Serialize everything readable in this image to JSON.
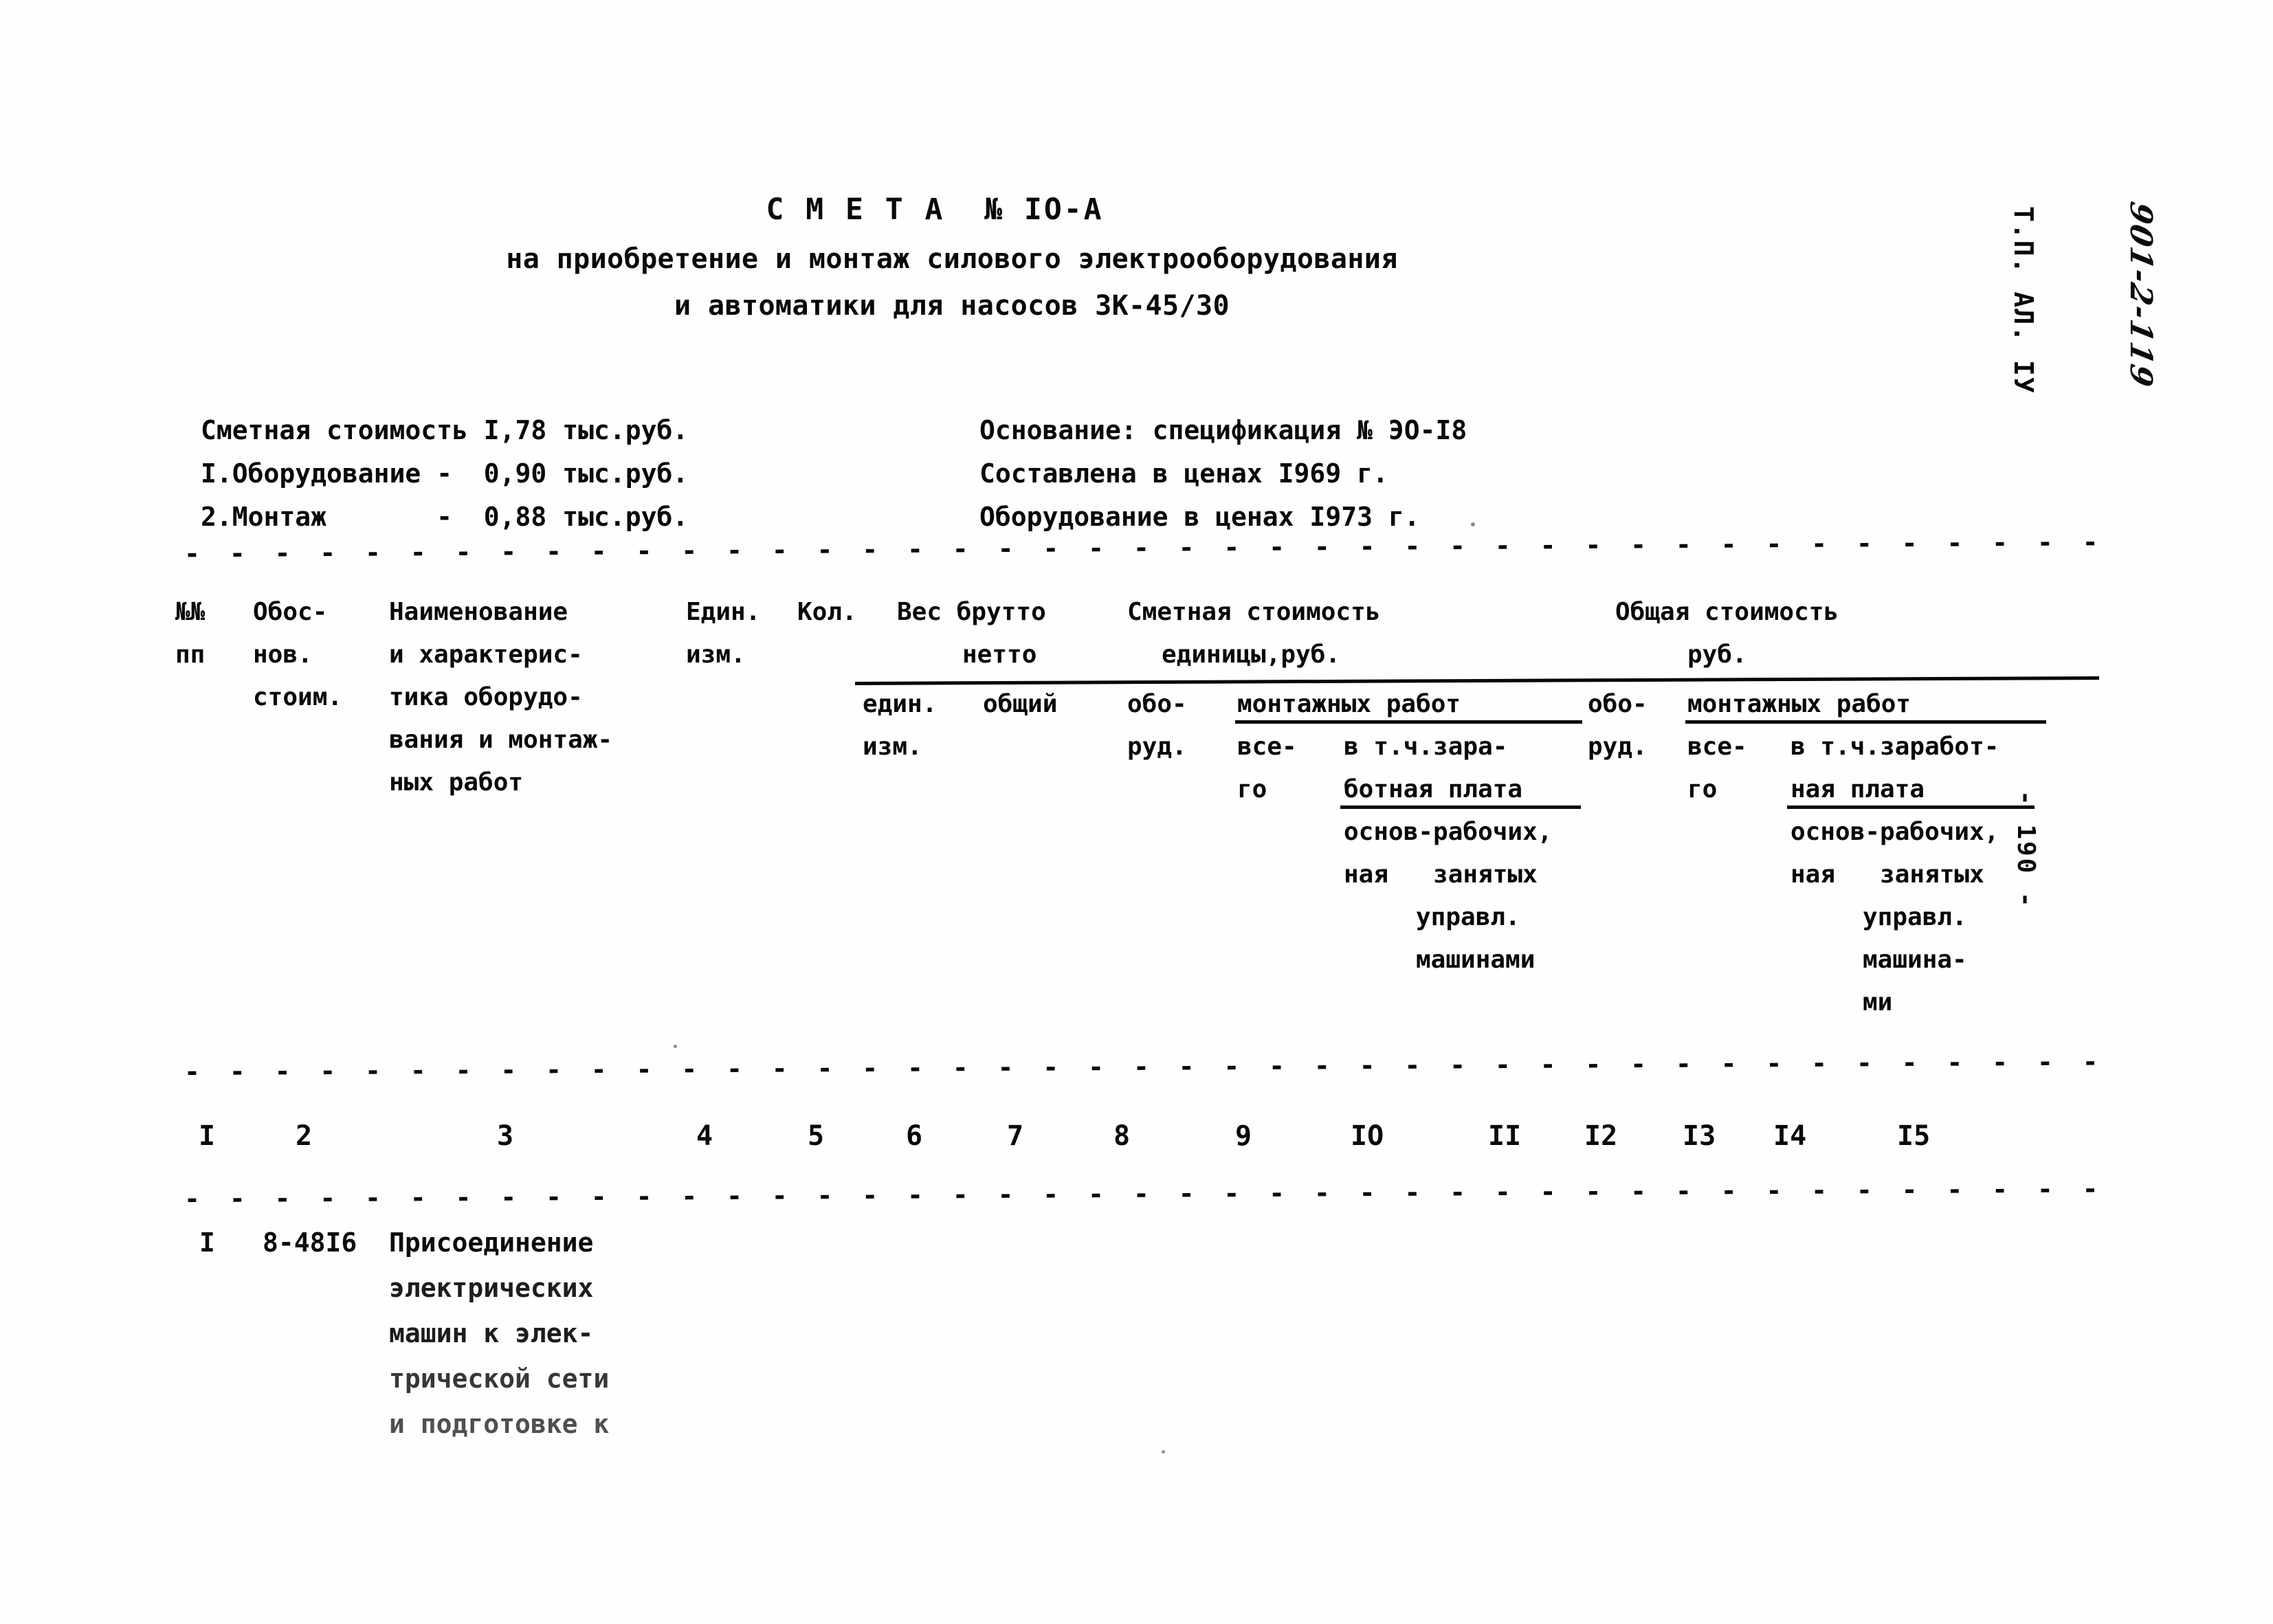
{
  "document": {
    "title": "С М Е Т А  № IО-А",
    "subtitle_line1": "на приобретение и монтаж силового электрооборудования",
    "subtitle_line2": "и автоматики для насосов 3К-45/30",
    "page_number": "- 190 -",
    "margin_stamp_typed": "Т.П. АЛ. IУ",
    "margin_stamp_handwritten": "901-2-119"
  },
  "summary": {
    "left": [
      "Сметная стоимость I,78 тыс.руб.",
      "I.Оборудование -  0,90 тыс.руб.",
      "2.Монтаж       -  0,88 тыс.руб."
    ],
    "right": [
      "Основание: спецификация № ЭО-I8",
      "Составлена в ценах I969 г.",
      "Оборудование в ценах I973 г."
    ]
  },
  "table": {
    "header": {
      "col1_line1": "№№",
      "col1_line2": "пп",
      "col2_line1": "Обос-",
      "col2_line2": "нов.",
      "col2_line3": "стоим.",
      "col3_line1": "Наименование",
      "col3_line2": "и характерис-",
      "col3_line3": "тика оборудо-",
      "col3_line4": "вания и монтаж-",
      "col3_line5": "ных работ",
      "col4_line1": "Един.",
      "col4_line2": "изм.",
      "col5_line1": "Кол.",
      "col6_group": "Вес брутто",
      "col6_group2": "нетто",
      "col6_sub1": "един.",
      "col6_sub2": "общий",
      "col6_sub3": "изм.",
      "col7_group_line1": "Сметная стоимость",
      "col7_group_line2": "единицы,руб.",
      "col8_obo": "обо-",
      "col8_rud": "руд.",
      "col9_group": "монтажных работ",
      "col9_vse": "все-",
      "col9_go": "го",
      "col10_line1": "в т.ч.зара-",
      "col10_line2": "ботная плата",
      "col10_line3": "основ-рабочих,",
      "col10_line4": "ная   занятых",
      "col10_line5": "управл.",
      "col10_line6": "машинами",
      "col11_group_line1": "Общая стоимость",
      "col11_group_line2": "руб.",
      "col12_obo": "обо-",
      "col12_rud": "руд.",
      "col13_group": "монтажных работ",
      "col13_vse": "все-",
      "col13_go": "го",
      "col14_line1": "в т.ч.заработ-",
      "col14_line2": "ная плата",
      "col14_line3": "основ-рабочих,",
      "col14_line4": "ная   занятых",
      "col14_line5": "управл.",
      "col14_line6": "машина-",
      "col14_line7": "ми"
    },
    "column_numbers": [
      "I",
      "2",
      "3",
      "4",
      "5",
      "6",
      "7",
      "8",
      "9",
      "IO",
      "II",
      "I2",
      "I3",
      "I4",
      "I5"
    ],
    "rows": [
      {
        "num": "I",
        "basis": "8-48I6",
        "description_lines": [
          "Присоединение",
          "электрических",
          "машин к элек-",
          "трической сети",
          "и подготовке к"
        ]
      }
    ]
  },
  "colors": {
    "ink": "#080808",
    "paper": "#fefefe"
  }
}
